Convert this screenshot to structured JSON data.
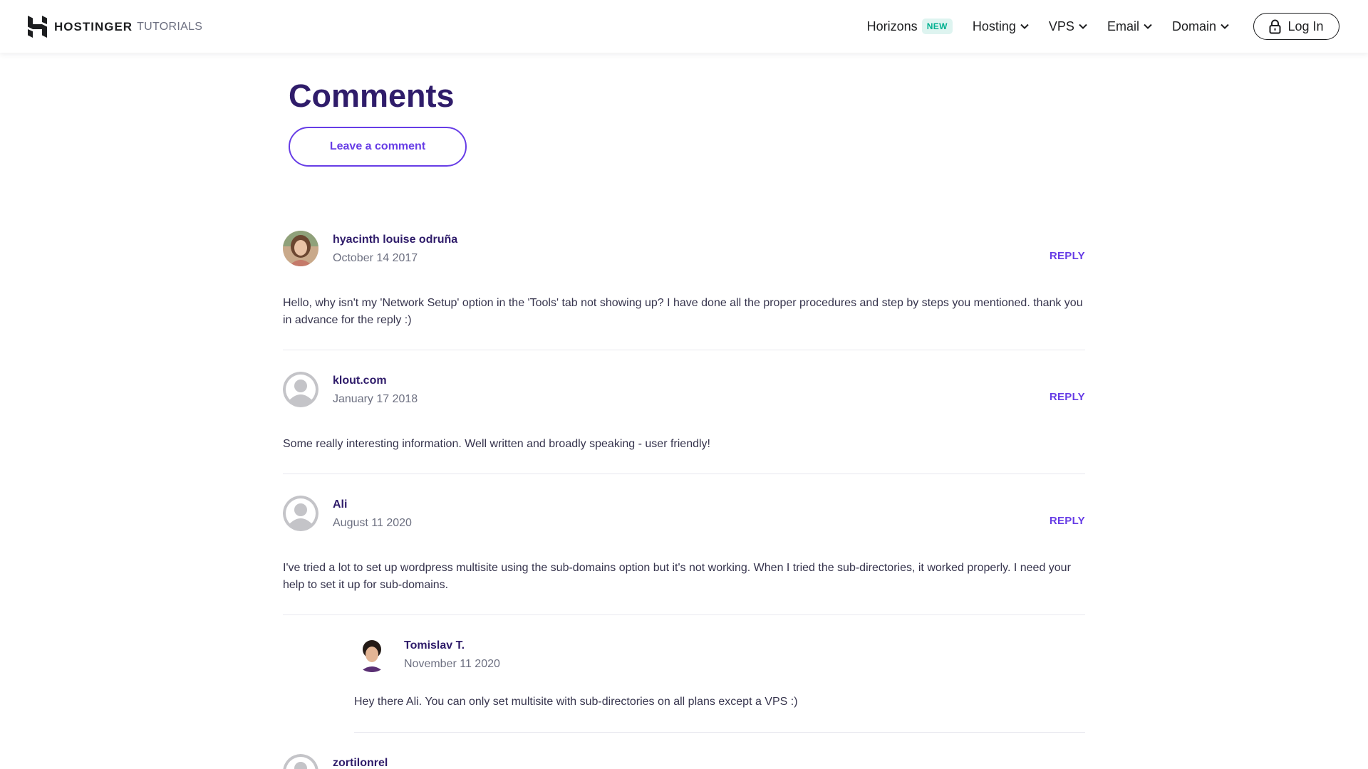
{
  "header": {
    "brand": "HOSTINGER",
    "brand_sub": "TUTORIALS",
    "nav": {
      "horizons": "Horizons",
      "new_badge": "NEW",
      "hosting": "Hosting",
      "vps": "VPS",
      "email": "Email",
      "domain": "Domain"
    },
    "login": "Log In"
  },
  "main": {
    "heading": "Comments",
    "leave_comment": "Leave a comment"
  },
  "comments": [
    {
      "author": "hyacinth louise odruña",
      "date": "October 14 2017",
      "reply": "REPLY",
      "text": "Hello, why isn't my 'Network Setup' option in the 'Tools' tab not showing up? I have done all the proper procedures and step by steps you mentioned. thank you in advance for the reply :)",
      "avatar": "photo-avatar"
    },
    {
      "author": "klout.com",
      "date": "January 17 2018",
      "reply": "REPLY",
      "text": "Some really interesting information. Well written and broadly speaking - user friendly!",
      "avatar": "default-avatar"
    },
    {
      "author": "Ali",
      "date": "August 11 2020",
      "reply": "REPLY",
      "text": "I've tried a lot to set up wordpress multisite using the sub-domains option but it's not working. When I tried the sub-directories, it worked properly. I need your help to set it up for sub-domains.",
      "avatar": "default-avatar"
    },
    {
      "author": "Tomislav T.",
      "date": "November 11 2020",
      "text": "Hey there Ali. You can only set multisite with sub-directories on all plans except a VPS :)",
      "avatar": "photo-avatar"
    },
    {
      "author": "zortilonrel",
      "avatar": "default-avatar"
    }
  ],
  "colors": {
    "primary_purple": "#673de6",
    "heading_navy": "#2f1c6a",
    "badge_green": "#00b090",
    "badge_bg": "#def4f0"
  }
}
